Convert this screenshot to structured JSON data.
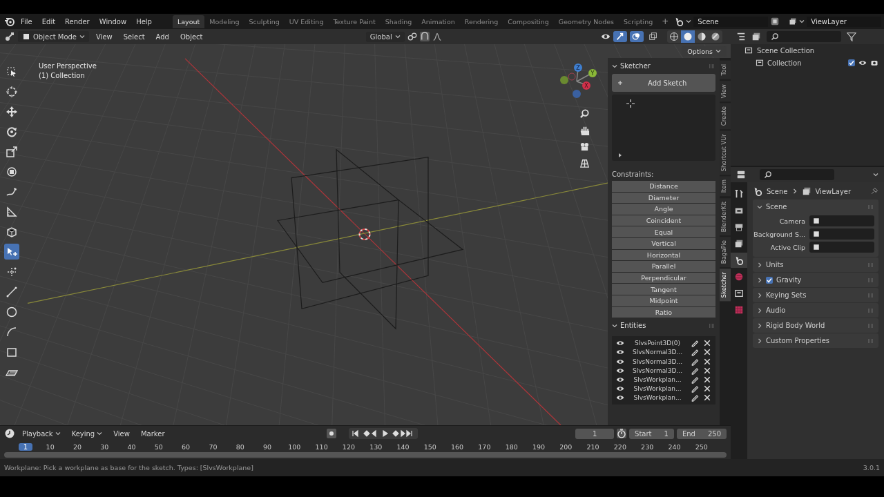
{
  "menu": [
    "File",
    "Edit",
    "Render",
    "Window",
    "Help"
  ],
  "workspaces": [
    {
      "label": "Layout",
      "selected": true
    },
    {
      "label": "Modeling",
      "selected": false
    },
    {
      "label": "Sculpting",
      "selected": false
    },
    {
      "label": "UV Editing",
      "selected": false
    },
    {
      "label": "Texture Paint",
      "selected": false
    },
    {
      "label": "Shading",
      "selected": false
    },
    {
      "label": "Animation",
      "selected": false
    },
    {
      "label": "Rendering",
      "selected": false
    },
    {
      "label": "Compositing",
      "selected": false
    },
    {
      "label": "Geometry Nodes",
      "selected": false
    },
    {
      "label": "Scripting",
      "selected": false
    }
  ],
  "add_workspace": "+",
  "scene": "Scene",
  "view_layer": "ViewLayer",
  "viewport_header": {
    "mode": "Object Mode",
    "menus": [
      "View",
      "Select",
      "Add",
      "Object"
    ],
    "orientation": "Global",
    "options": "Options",
    "shading_modes": [
      {
        "kind": "wireframe",
        "selected": false
      },
      {
        "kind": "solid",
        "selected": true
      },
      {
        "kind": "material",
        "selected": false
      },
      {
        "kind": "rendered",
        "selected": false
      }
    ],
    "toggles": [
      {
        "kind": "gizmo",
        "on": true
      },
      {
        "kind": "overlay",
        "on": true
      },
      {
        "kind": "xray",
        "on": false
      }
    ]
  },
  "viewport": {
    "view_name": "User Perspective",
    "collection": "(1) Collection",
    "gizmo": [
      "Z",
      "Y",
      "X"
    ]
  },
  "toolbar": [
    {
      "kind": "select",
      "selected": false
    },
    {
      "kind": "cursor",
      "selected": false
    },
    {
      "kind": "move",
      "selected": false
    },
    {
      "kind": "rotate",
      "selected": false
    },
    {
      "kind": "scale",
      "selected": false
    },
    {
      "kind": "transform",
      "selected": false
    },
    {
      "kind": "annotate",
      "selected": false
    },
    {
      "kind": "measure",
      "selected": false
    },
    {
      "kind": "cube",
      "selected": false
    },
    {
      "kind": "sketch",
      "selected": true
    },
    {
      "kind": "point",
      "selected": false
    },
    {
      "kind": "line",
      "selected": false
    },
    {
      "kind": "circle",
      "selected": false
    },
    {
      "kind": "arc",
      "selected": false
    },
    {
      "kind": "rectangle",
      "selected": false
    },
    {
      "kind": "workplane",
      "selected": false
    }
  ],
  "sidebar": {
    "title": "Sketcher",
    "add_button": "Add Sketch",
    "constraints_label": "Constraints:",
    "constraints": [
      "Distance",
      "Diameter",
      "Angle",
      "Coincident",
      "Equal",
      "Vertical",
      "Horizontal",
      "Parallel",
      "Perpendicular",
      "Tangent",
      "Midpoint",
      "Ratio"
    ],
    "entities_title": "Entities",
    "entities": [
      "SlvsPoint3D(0)",
      "SlvsNormal3D...",
      "SlvsNormal3D...",
      "SlvsNormal3D...",
      "SlvsWorkplan...",
      "SlvsWorkplan...",
      "SlvsWorkplan..."
    ]
  },
  "sidebar_tabs": [
    {
      "label": "Tool",
      "selected": false
    },
    {
      "label": "View",
      "selected": false
    },
    {
      "label": "Create",
      "selected": false
    },
    {
      "label": "Shortcut VUr",
      "selected": false
    },
    {
      "label": "Item",
      "selected": false
    },
    {
      "label": "BlenderKit",
      "selected": false
    },
    {
      "label": "BagaPie",
      "selected": false
    },
    {
      "label": "Sketcher",
      "selected": true
    }
  ],
  "outliner": [
    {
      "label": "Scene Collection",
      "children": [
        {
          "label": "Collection",
          "checked": true
        }
      ]
    }
  ],
  "properties": {
    "breadcrumb": [
      "Scene",
      "ViewLayer"
    ],
    "tabs": [
      {
        "kind": "tool",
        "selected": false
      },
      {
        "kind": "render",
        "selected": false
      },
      {
        "kind": "output",
        "selected": false
      },
      {
        "kind": "view-layer",
        "selected": false
      },
      {
        "kind": "scene",
        "selected": true
      },
      {
        "kind": "world",
        "selected": false
      },
      {
        "kind": "collection",
        "selected": false
      },
      {
        "kind": "texture",
        "selected": false
      }
    ],
    "panels": [
      {
        "title": "Scene",
        "expanded": true,
        "kind": "plain",
        "fields": [
          "Camera",
          "Background S...",
          "Active Clip"
        ]
      },
      {
        "title": "Units",
        "expanded": false,
        "kind": "plain"
      },
      {
        "title": "Gravity",
        "expanded": false,
        "kind": "checkbox",
        "checked": true
      },
      {
        "title": "Keying Sets",
        "expanded": false,
        "kind": "plain"
      },
      {
        "title": "Audio",
        "expanded": false,
        "kind": "plain"
      },
      {
        "title": "Rigid Body World",
        "expanded": false,
        "kind": "plain"
      },
      {
        "title": "Custom Properties",
        "expanded": false,
        "kind": "plain"
      }
    ]
  },
  "timeline": {
    "menus": [
      {
        "label": "Playback",
        "dropdown": true
      },
      {
        "label": "Keying",
        "dropdown": true
      },
      {
        "label": "View",
        "dropdown": false
      },
      {
        "label": "Marker",
        "dropdown": false
      }
    ],
    "current_frame": "1",
    "start_label": "Start",
    "start": "1",
    "end_label": "End",
    "end": "250",
    "playhead": "1",
    "ruler": [
      "10",
      "20",
      "30",
      "40",
      "50",
      "60",
      "70",
      "80",
      "90",
      "100",
      "110",
      "120",
      "130",
      "140",
      "150",
      "160",
      "170",
      "180",
      "190",
      "200",
      "210",
      "220",
      "230",
      "240",
      "250"
    ]
  },
  "status": {
    "hint": "Workplane: Pick a workplane as base for the sketch. Types: [SlvsWorkplane]",
    "version": "3.0.1"
  }
}
